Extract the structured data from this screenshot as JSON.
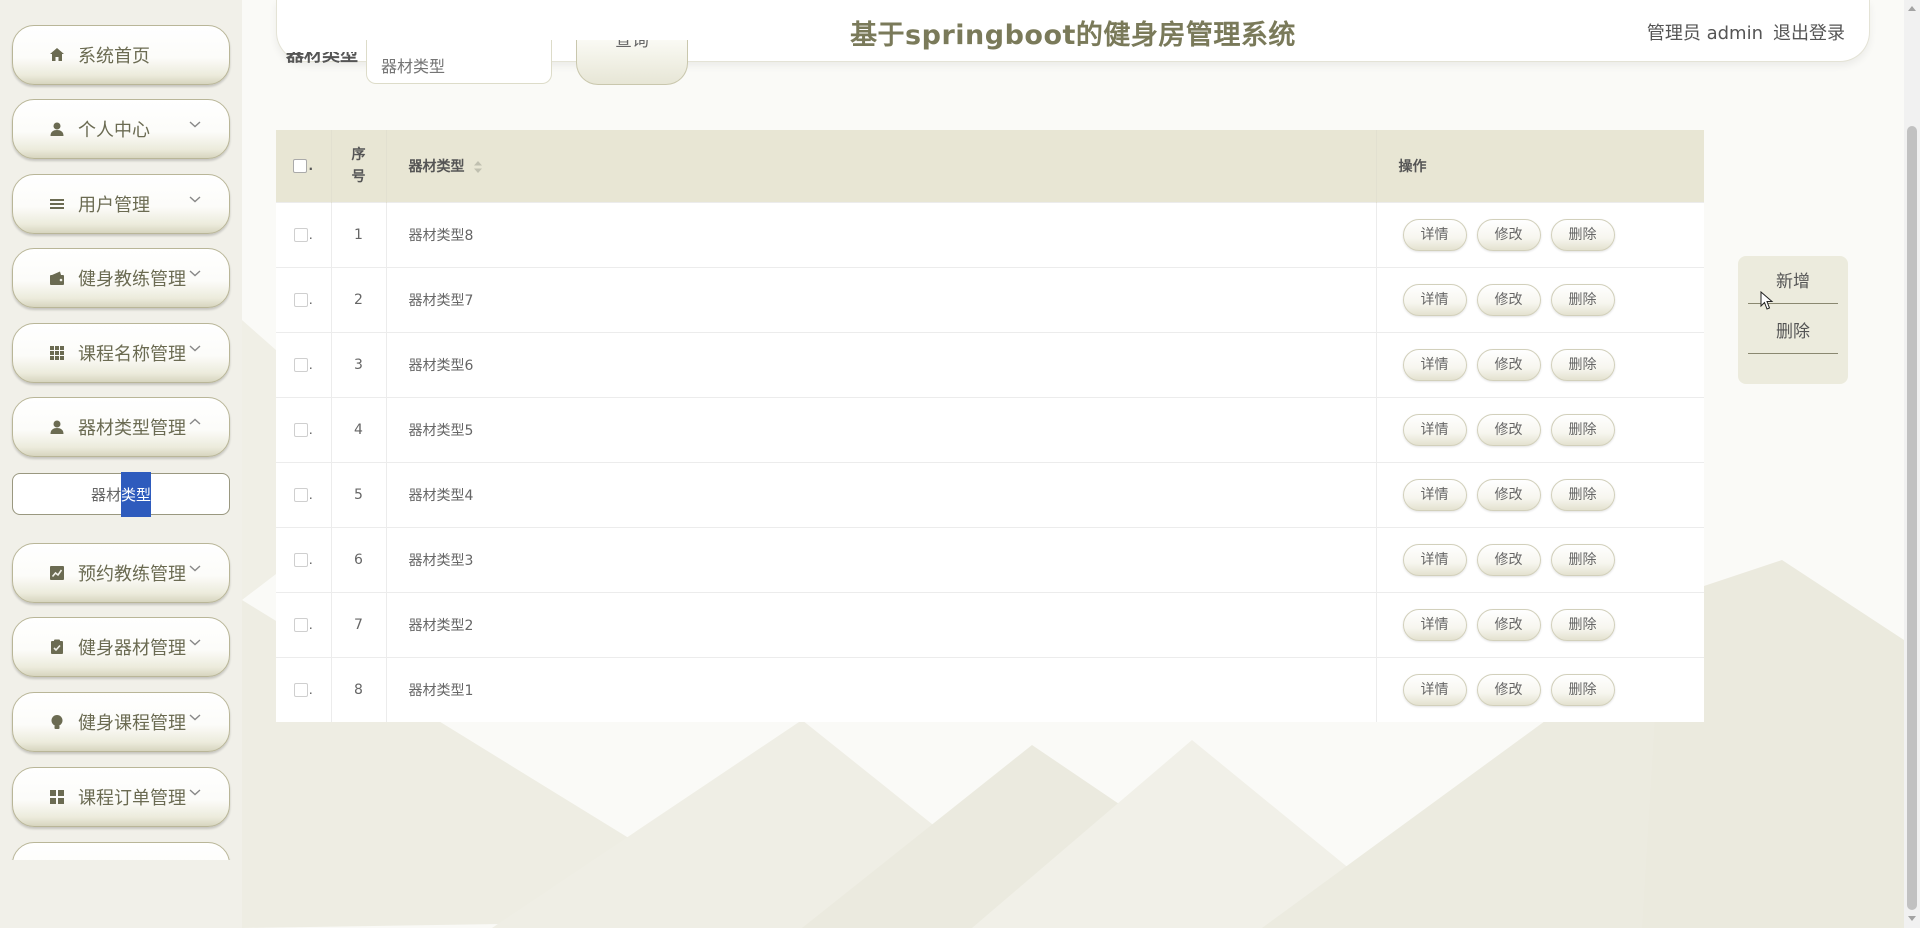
{
  "header": {
    "title": "基于springboot的健身房管理系统",
    "user": "管理员 admin",
    "logout": "退出登录"
  },
  "sidebar": {
    "items": [
      {
        "label": "系统首页",
        "icon": "home-icon"
      },
      {
        "label": "个人中心",
        "icon": "user-icon"
      },
      {
        "label": "用户管理",
        "icon": "list-icon"
      },
      {
        "label": "健身教练管理",
        "icon": "wallet-icon"
      },
      {
        "label": "课程名称管理",
        "icon": "grid-icon"
      },
      {
        "label": "器材类型管理",
        "icon": "user-icon"
      },
      {
        "label": "预约教练管理",
        "icon": "chart-icon"
      },
      {
        "label": "健身器材管理",
        "icon": "clipboard-icon"
      },
      {
        "label": "健身课程管理",
        "icon": "bulb-icon"
      },
      {
        "label": "课程订单管理",
        "icon": "apps-icon"
      }
    ],
    "submenu": {
      "label_a": "器材",
      "label_b": "类型"
    }
  },
  "search": {
    "label": "器材类型",
    "placeholder": "器材类型",
    "button": "查询"
  },
  "table": {
    "columns": {
      "index": "序号",
      "type": "器材类型",
      "ops": "操作"
    },
    "rows": [
      {
        "index": "1",
        "type": "器材类型8"
      },
      {
        "index": "2",
        "type": "器材类型7"
      },
      {
        "index": "3",
        "type": "器材类型6"
      },
      {
        "index": "4",
        "type": "器材类型5"
      },
      {
        "index": "5",
        "type": "器材类型4"
      },
      {
        "index": "6",
        "type": "器材类型3"
      },
      {
        "index": "7",
        "type": "器材类型2"
      },
      {
        "index": "8",
        "type": "器材类型1"
      }
    ],
    "ops": {
      "detail": "详情",
      "edit": "修改",
      "delete": "删除"
    }
  },
  "float_panel": {
    "add": "新增",
    "delete": "删除"
  },
  "colors": {
    "accent": "#7a7a5a",
    "header_bg": "#e8e6d4",
    "selection": "#2e5bbd"
  }
}
